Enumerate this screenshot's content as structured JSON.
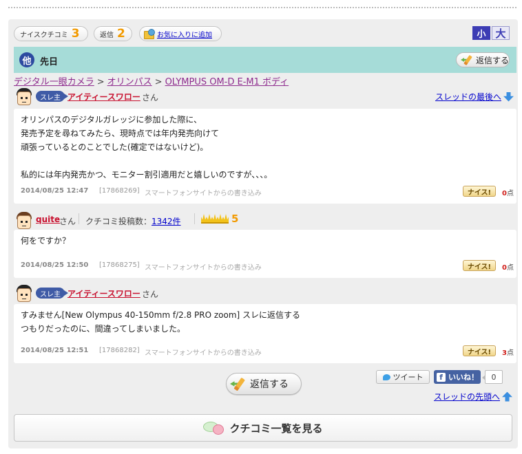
{
  "toolbar": {
    "nice_label": "ナイスクチコミ",
    "nice_count": "3",
    "reply_label": "返信",
    "reply_count": "2",
    "favorite_label": "お気に入りに追加",
    "size_small": "小",
    "size_large": "大"
  },
  "thread": {
    "category_badge": "他",
    "title": "先日",
    "reply_button": "返信する"
  },
  "breadcrumb": {
    "items": [
      "デジタル一眼カメラ",
      "オリンパス",
      "OLYMPUS OM-D E-M1 ボディ"
    ],
    "separator": ">"
  },
  "posts": [
    {
      "badge": "スレ主",
      "user": "アイティースワロー",
      "honorific": "さん",
      "jump_link": "スレッドの最後へ",
      "text": "オリンパスのデジタルガレッジに参加した際に、\n発売予定を尋ねてみたら、現時点では年内発売向けて\n頑張っているとのことでした(確定ではないけど)。\n\n私的には年内発売かつ、モニター割引適用だと嬉しいのですが、、、。",
      "date": "2014/08/25 12:47",
      "id": "[17868269]",
      "source": "スマートフォンサイトからの書き込み",
      "nice_label": "ナイス!",
      "nice_count": "0",
      "nice_unit": "点"
    },
    {
      "user": "quite",
      "honorific": "さん",
      "posts_label": "クチコミ投稿数：",
      "posts_count": "1342件",
      "rank": "5",
      "text": "何をですか？",
      "date": "2014/08/25 12:50",
      "id": "[17868275]",
      "source": "スマートフォンサイトからの書き込み",
      "nice_label": "ナイス!",
      "nice_count": "0",
      "nice_unit": "点"
    },
    {
      "badge": "スレ主",
      "user": "アイティースワロー",
      "honorific": "さん",
      "text": "すみません[New Olympus 40-150mm f/2.8 PRO zoom] スレに返信する\nつもりだったのに、間違ってしまいました。",
      "date": "2014/08/25 12:51",
      "id": "[17868282]",
      "source": "スマートフォンサイトからの書き込み",
      "nice_label": "ナイス!",
      "nice_count": "3",
      "nice_unit": "点"
    }
  ],
  "bottom": {
    "reply_button": "返信する",
    "tweet": "ツイート",
    "like": "いいね！",
    "like_count": "0",
    "to_top": "スレッドの先頭へ",
    "view_list": "クチコミ一覧を見る"
  }
}
